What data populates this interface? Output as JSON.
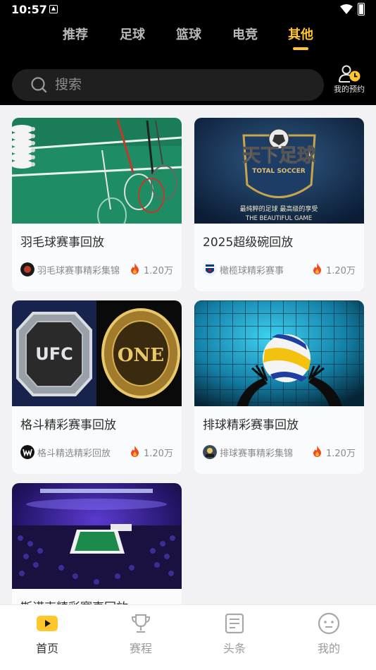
{
  "status": {
    "time": "10:57"
  },
  "tabs": [
    {
      "label": "推荐",
      "active": false
    },
    {
      "label": "足球",
      "active": false
    },
    {
      "label": "篮球",
      "active": false
    },
    {
      "label": "电竞",
      "active": false
    },
    {
      "label": "其他",
      "active": true
    }
  ],
  "search": {
    "placeholder": "搜索"
  },
  "reservation": {
    "label": "我的预约"
  },
  "cards": [
    {
      "title": "羽毛球赛事回放",
      "source": "羽毛球赛事精彩集锦",
      "views": "1.20万",
      "thumb_icon": "badminton-image"
    },
    {
      "title": "2025超级碗回放",
      "source": "橄榄球精彩赛事",
      "views": "1.20万",
      "thumb_icon": "total-soccer-logo-image",
      "thumb_text": {
        "logo": "天下足球",
        "sub": "TOTAL SOCCER",
        "slogan": "最纯粹的足球  最高级的享受",
        "tagline": "THE BEAUTIFUL GAME"
      }
    },
    {
      "title": "格斗精彩赛事回放",
      "source": "格斗精选精彩回放",
      "views": "1.20万",
      "thumb_icon": "ufc-one-belts-image",
      "thumb_text": {
        "left": "UFC",
        "right": "ONE"
      }
    },
    {
      "title": "排球精彩赛事回放",
      "source": "排球赛事精彩集锦",
      "views": "1.20万",
      "thumb_icon": "volleyball-image"
    },
    {
      "title": "斯诺克精彩赛事回放",
      "source": "",
      "views": "",
      "thumb_icon": "snooker-arena-image"
    }
  ],
  "tabbar": [
    {
      "label": "首页",
      "icon": "play-icon",
      "active": true
    },
    {
      "label": "赛程",
      "icon": "trophy-icon",
      "active": false
    },
    {
      "label": "头条",
      "icon": "news-icon",
      "active": false
    },
    {
      "label": "我的",
      "icon": "profile-icon",
      "active": false
    }
  ],
  "colors": {
    "accent": "#ffc72c",
    "header_bg": "#000000",
    "page_bg": "#f2f2f4"
  }
}
